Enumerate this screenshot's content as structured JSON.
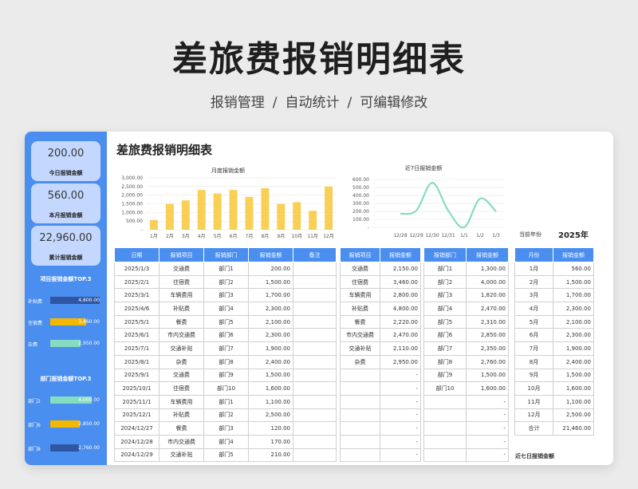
{
  "hero": {
    "title": "差旅费报销明细表",
    "tags": [
      "报销管理",
      "自动统计",
      "可编辑修改"
    ],
    "sep": "/"
  },
  "sidebar": {
    "kpis": [
      {
        "value": "200.00",
        "label": "今日报销金额"
      },
      {
        "value": "560.00",
        "label": "本月报销金额"
      },
      {
        "value": "22,960.00",
        "label": "累计报销金额"
      }
    ],
    "item_top_title": "项目报销金额TOP.3",
    "item_top": [
      {
        "label": "补贴费",
        "value": "4,800.00",
        "amount": 4800,
        "color": "#2f56a3"
      },
      {
        "label": "住宿费",
        "value": "3,460.00",
        "amount": 3460,
        "color": "#f5b800"
      },
      {
        "label": "杂费",
        "value": "2,950.00",
        "amount": 2950,
        "color": "#86dcc0"
      }
    ],
    "dept_top_title": "部门报销金额TOP.3",
    "dept_top": [
      {
        "label": "部门2",
        "value": "4,000.00",
        "amount": 4000,
        "color": "#86dcc0"
      },
      {
        "label": "部门6",
        "value": "2,850.00",
        "amount": 2850,
        "color": "#f5b800"
      },
      {
        "label": "部门8",
        "value": "2,760.00",
        "amount": 2760,
        "color": "#2f56a3"
      }
    ]
  },
  "main_title": "差旅费报销明细表",
  "chart_data": [
    {
      "type": "bar",
      "title": "月度报销金额",
      "categories": [
        "1月",
        "2月",
        "3月",
        "4月",
        "5月",
        "6月",
        "7月",
        "8月",
        "9月",
        "10月",
        "11月",
        "12月"
      ],
      "values": [
        560,
        1500,
        1700,
        2300,
        2100,
        2300,
        1900,
        2400,
        1500,
        1600,
        1100,
        2500
      ],
      "ylim": [
        0,
        3000
      ],
      "yticks": [
        "-",
        "500.00",
        "1,000.00",
        "1,500.00",
        "2,000.00",
        "2,500.00",
        "3,000.00"
      ],
      "color": "#f9cf55",
      "grid": true
    },
    {
      "type": "line",
      "title": "近7日报销金额",
      "categories": [
        "12/28",
        "12/29",
        "12/30",
        "12/31",
        "1/1",
        "1/2",
        "1/3"
      ],
      "values": [
        170,
        210,
        560,
        210,
        0,
        360,
        200
      ],
      "ylim": [
        0,
        600
      ],
      "yticks": [
        "-",
        "100.00",
        "200.00",
        "300.00",
        "400.00",
        "500.00",
        "600.00"
      ],
      "color": "#86dcc0",
      "grid": true
    }
  ],
  "detail": {
    "headers": [
      "日期",
      "报销项目",
      "报销部门",
      "报销金额",
      "备注"
    ],
    "rows": [
      [
        "2025/1/3",
        "交通费",
        "部门1",
        "200.00",
        ""
      ],
      [
        "2025/2/1",
        "住宿费",
        "部门2",
        "1,500.00",
        ""
      ],
      [
        "2025/3/1",
        "车辆费用",
        "部门3",
        "1,700.00",
        ""
      ],
      [
        "2025/4/6",
        "补贴费",
        "部门4",
        "2,300.00",
        ""
      ],
      [
        "2025/5/1",
        "餐费",
        "部门5",
        "2,100.00",
        ""
      ],
      [
        "2025/6/1",
        "市内交通费",
        "部门6",
        "2,300.00",
        ""
      ],
      [
        "2025/7/1",
        "交通补贴",
        "部门7",
        "1,900.00",
        ""
      ],
      [
        "2025/8/1",
        "杂费",
        "部门8",
        "2,400.00",
        ""
      ],
      [
        "2025/9/1",
        "交通费",
        "部门9",
        "1,500.00",
        ""
      ],
      [
        "2025/10/1",
        "住宿费",
        "部门10",
        "1,600.00",
        ""
      ],
      [
        "2025/11/1",
        "车辆费用",
        "部门1",
        "1,100.00",
        ""
      ],
      [
        "2025/12/1",
        "补贴费",
        "部门2",
        "2,500.00",
        ""
      ],
      [
        "2024/12/27",
        "餐费",
        "部门3",
        "120.00",
        ""
      ],
      [
        "2024/12/28",
        "市内交通费",
        "部门4",
        "170.00",
        ""
      ],
      [
        "2024/12/29",
        "交通补贴",
        "部门5",
        "210.00",
        ""
      ]
    ]
  },
  "by_item": {
    "headers": [
      "报销项目",
      "报销金额"
    ],
    "rows": [
      [
        "交通费",
        "2,150.00"
      ],
      [
        "住宿费",
        "3,460.00"
      ],
      [
        "车辆费用",
        "2,800.00"
      ],
      [
        "补贴费",
        "4,800.00"
      ],
      [
        "餐费",
        "2,220.00"
      ],
      [
        "市内交通费",
        "2,470.00"
      ],
      [
        "交通补贴",
        "2,110.00"
      ],
      [
        "杂费",
        "2,950.00"
      ],
      [
        "",
        "-"
      ],
      [
        "",
        "-"
      ],
      [
        "",
        "-"
      ],
      [
        "",
        "-"
      ],
      [
        "",
        "-"
      ],
      [
        "",
        "-"
      ],
      [
        "",
        "-"
      ]
    ]
  },
  "by_dept": {
    "headers": [
      "报销部门",
      "报销金额"
    ],
    "rows": [
      [
        "部门1",
        "1,300.00"
      ],
      [
        "部门2",
        "4,000.00"
      ],
      [
        "部门3",
        "1,820.00"
      ],
      [
        "部门4",
        "2,470.00"
      ],
      [
        "部门5",
        "2,310.00"
      ],
      [
        "部门6",
        "2,850.00"
      ],
      [
        "部门7",
        "2,350.00"
      ],
      [
        "部门8",
        "2,760.00"
      ],
      [
        "部门9",
        "1,500.00"
      ],
      [
        "部门10",
        "1,600.00"
      ],
      [
        "",
        "-"
      ],
      [
        "",
        "-"
      ],
      [
        "",
        "-"
      ],
      [
        "",
        "-"
      ],
      [
        "",
        "-"
      ]
    ]
  },
  "year_label": "当前年份",
  "year_value": "2025年",
  "by_month": {
    "headers": [
      "月份",
      "报销金额"
    ],
    "rows": [
      [
        "1月",
        "560.00"
      ],
      [
        "2月",
        "1,500.00"
      ],
      [
        "3月",
        "1,700.00"
      ],
      [
        "4月",
        "2,300.00"
      ],
      [
        "5月",
        "2,100.00"
      ],
      [
        "6月",
        "2,300.00"
      ],
      [
        "7月",
        "1,900.00"
      ],
      [
        "8月",
        "2,400.00"
      ],
      [
        "9月",
        "1,500.00"
      ],
      [
        "10月",
        "1,600.00"
      ],
      [
        "11月",
        "1,100.00"
      ],
      [
        "12月",
        "2,500.00"
      ],
      [
        "合计",
        "21,460.00"
      ]
    ]
  },
  "footer_label": "近七日报销金额"
}
